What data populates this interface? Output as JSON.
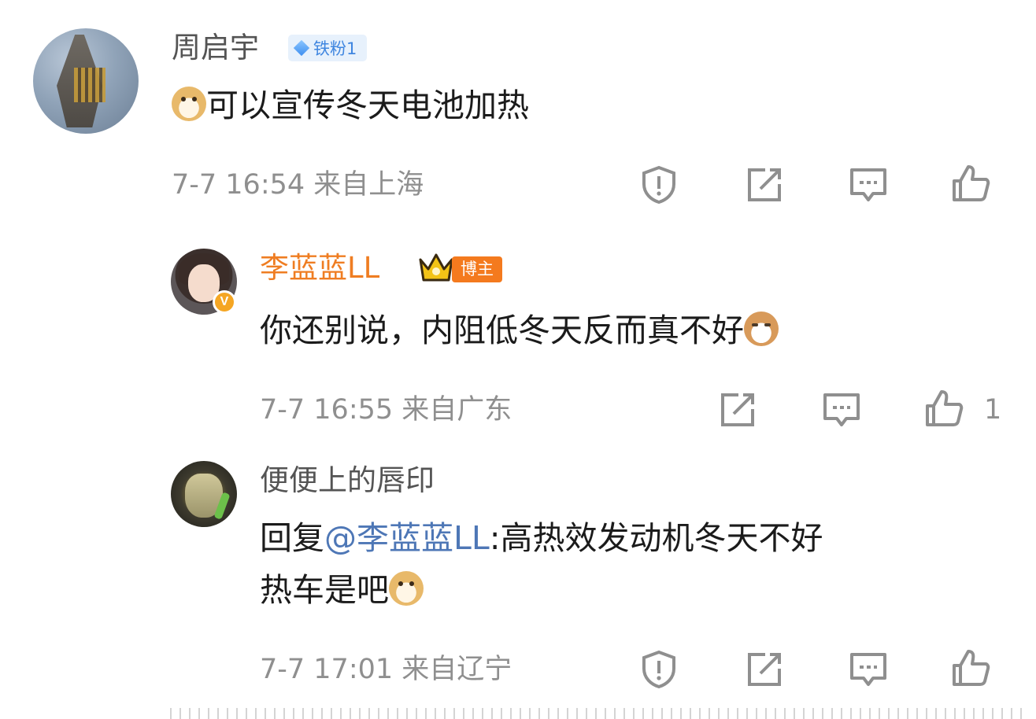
{
  "comments": [
    {
      "username": "周启宇",
      "fan_badge": "铁粉1",
      "text": "可以宣传冬天电池加热",
      "emoji": "doge-emoji",
      "date": "7-7 16:54",
      "location": "来自上海",
      "icons": [
        "report-icon",
        "share-icon",
        "comment-icon",
        "like-icon"
      ]
    },
    {
      "username": "李蓝蓝LL",
      "role_badge": "博主",
      "verified_mark": "V",
      "text": "你还别说，内阻低冬天反而真不好",
      "emoji": "cat-emoji",
      "date": "7-7 16:55",
      "location": "来自广东",
      "like_count": "1",
      "icons": [
        "share-icon",
        "comment-icon",
        "like-icon"
      ]
    },
    {
      "username": "便便上的唇印",
      "reply_prefix": "回复",
      "mention": "@李蓝蓝LL",
      "text_line1": ":高热效发动机冬天不好",
      "text_line2": "热车是吧",
      "emoji": "doge-emoji",
      "date": "7-7 17:01",
      "location": "来自辽宁",
      "icons": [
        "report-icon",
        "share-icon",
        "comment-icon",
        "like-icon"
      ]
    }
  ],
  "colors": {
    "username_default": "#545454",
    "username_blogger": "#ef7d22",
    "mention": "#4e77b6",
    "meta": "#8f8f8f"
  }
}
